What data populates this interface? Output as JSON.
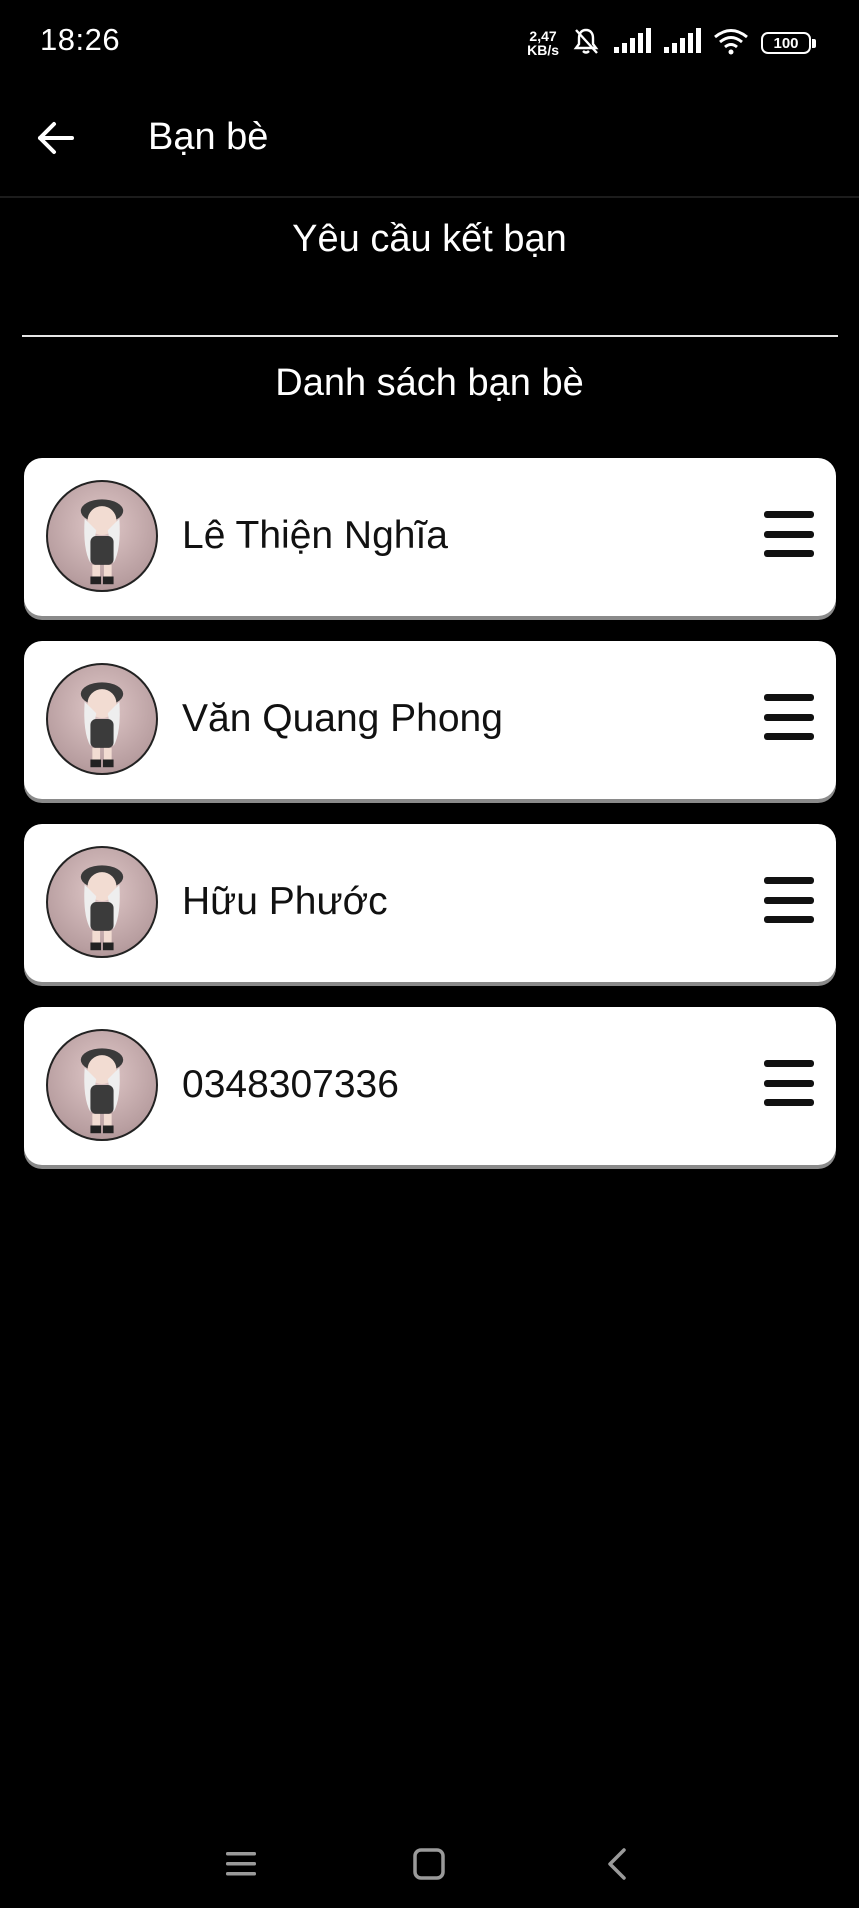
{
  "status_bar": {
    "time": "18:26",
    "net_speed_value": "2,47",
    "net_speed_unit": "KB/s",
    "battery": "100"
  },
  "app_bar": {
    "title": "Bạn bè"
  },
  "sections": {
    "requests_label": "Yêu cầu kết bạn",
    "friends_label": "Danh sách bạn bè"
  },
  "friends": [
    {
      "name": "Lê Thiện Nghĩa"
    },
    {
      "name": "Văn Quang Phong"
    },
    {
      "name": "Hữu Phước"
    },
    {
      "name": "0348307336"
    }
  ],
  "icons": {
    "back": "arrow-left-icon",
    "menu": "hamburger-menu-icon",
    "nav_recents": "recents-icon",
    "nav_home": "home-icon",
    "nav_back": "back-icon"
  },
  "colors": {
    "background": "#000000",
    "card": "#ffffff",
    "text_dark": "#111111"
  }
}
